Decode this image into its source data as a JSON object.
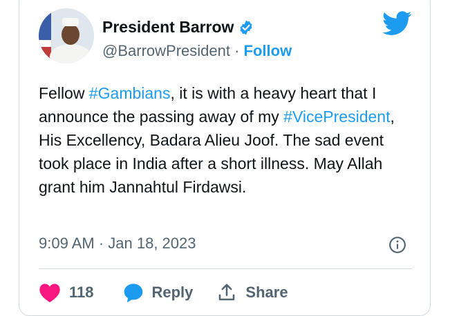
{
  "author": {
    "name": "President Barrow",
    "handle": "@BarrowPresident",
    "separator": "·",
    "follow_label": "Follow"
  },
  "tweet": {
    "part1": "Fellow ",
    "hashtag1": "#Gambians",
    "part2": ", it is with a heavy heart that I announce the passing away of my ",
    "hashtag2": "#VicePresident",
    "part3": ", His Excellency, Badara Alieu Joof. The sad event took place in India after a short illness. May Allah grant him Jannahtul Firdawsi."
  },
  "meta": {
    "timestamp": "9:09 AM · Jan 18, 2023"
  },
  "actions": {
    "like_count": "118",
    "reply_label": "Reply",
    "share_label": "Share"
  },
  "icons": {
    "bird": "twitter-bird-icon",
    "verified": "verified-badge-icon",
    "info": "info-icon",
    "heart": "heart-icon",
    "reply": "reply-bubble-icon",
    "share": "share-icon"
  },
  "colors": {
    "brand_blue": "#1d9bf0",
    "like_pink": "#f91880",
    "text": "#0f1419",
    "muted": "#536471",
    "border": "#cfd9de"
  }
}
